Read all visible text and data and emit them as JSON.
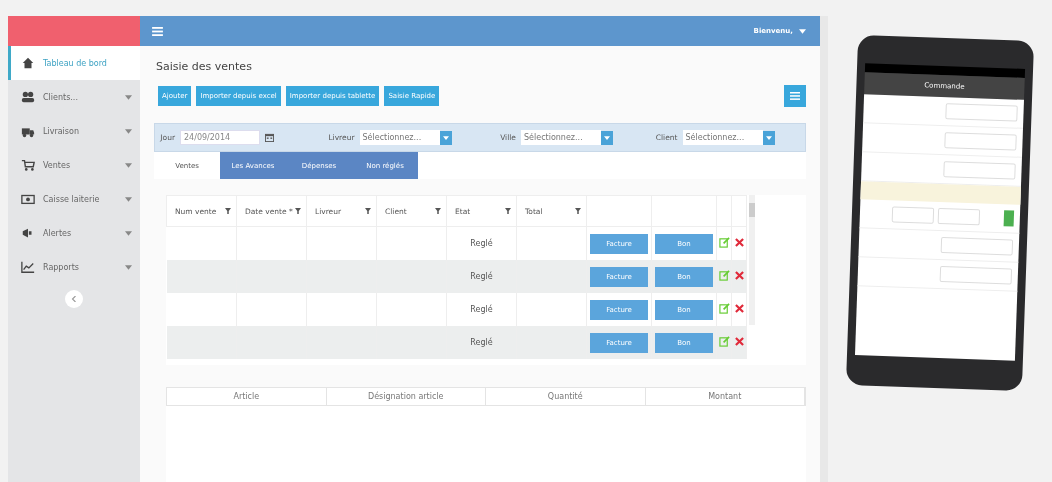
{
  "header": {
    "welcome": "Bienvenu,"
  },
  "sidebar": {
    "items": [
      {
        "label": "Tableau de bord",
        "selected": true,
        "expandable": false
      },
      {
        "label": "Clients...",
        "selected": false,
        "expandable": true
      },
      {
        "label": "Livraison",
        "selected": false,
        "expandable": true
      },
      {
        "label": "Ventes",
        "selected": false,
        "expandable": true
      },
      {
        "label": "Caisse laiterie",
        "selected": false,
        "expandable": true
      },
      {
        "label": "Alertes",
        "selected": false,
        "expandable": true
      },
      {
        "label": "Rapports",
        "selected": false,
        "expandable": true
      }
    ]
  },
  "page": {
    "title": "Saisie des ventes",
    "actions": [
      "Ajouter",
      "Importer depuis excel",
      "Importer depuis tablette",
      "Saisie Rapide"
    ],
    "filters": [
      {
        "label": "Jour",
        "kind": "date",
        "value": "24/09/2014"
      },
      {
        "label": "Livreur",
        "kind": "select",
        "placeholder": "Sélectionnez..."
      },
      {
        "label": "Ville",
        "kind": "select",
        "placeholder": "Sélectionnez..."
      },
      {
        "label": "Client",
        "kind": "select",
        "placeholder": "Sélectionnez..."
      }
    ],
    "tabs": [
      {
        "label": "Ventes",
        "selected": true
      },
      {
        "label": "Les Avances",
        "selected": false
      },
      {
        "label": "Dépenses",
        "selected": false
      },
      {
        "label": "Non réglés",
        "selected": false
      }
    ],
    "table": {
      "columns": [
        "Num vente",
        "Date vente *",
        "Livreur",
        "Client",
        "Etat",
        "Total"
      ],
      "rows": [
        {
          "etat": "Reglé",
          "invoice": "Facture",
          "receipt": "Bon"
        },
        {
          "etat": "Reglé",
          "invoice": "Facture",
          "receipt": "Bon"
        },
        {
          "etat": "Reglé",
          "invoice": "Facture",
          "receipt": "Bon"
        },
        {
          "etat": "Reglé",
          "invoice": "Facture",
          "receipt": "Bon"
        }
      ]
    },
    "detail_table": {
      "columns": [
        "Article",
        "Désignation article",
        "Quantité",
        "Montant"
      ]
    }
  },
  "tablet": {
    "title": "Commande"
  }
}
